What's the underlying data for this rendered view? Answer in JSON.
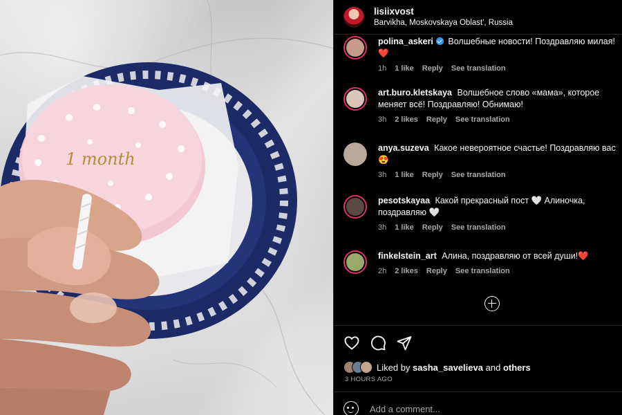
{
  "post": {
    "username": "lisiixvost",
    "location": "Barvikha, Moskovskaya Oblast', Russia",
    "photo_text": "1 month"
  },
  "comments": [
    {
      "user": "polina_askeri",
      "verified": true,
      "text": "Волшебные новости! Поздравляю милая! ❤️",
      "time": "1h",
      "likes": "1 like",
      "reply": "Reply",
      "translate": "See translation",
      "avatar_color": "#c79a8a"
    },
    {
      "user": "art.buro.kletskaya",
      "verified": false,
      "text": "Волшебное слово «мама», которое меняет всё! Поздравляю! Обнимаю!",
      "time": "3h",
      "likes": "2 likes",
      "reply": "Reply",
      "translate": "See translation",
      "avatar_color": "#d8c7b8"
    },
    {
      "user": "anya.suzeva",
      "verified": false,
      "text": "Какое невероятное счастье! Поздравляю вас😍",
      "time": "3h",
      "likes": "1 like",
      "reply": "Reply",
      "translate": "See translation",
      "avatar_color": "#b8a89a"
    },
    {
      "user": "pesotskayaa",
      "verified": false,
      "text": "Какой прекрасный пост 🤍 Алиночка, поздравляю 🤍",
      "time": "3h",
      "likes": "1 like",
      "reply": "Reply",
      "translate": "See translation",
      "avatar_color": "#5a4a44"
    },
    {
      "user": "finkelstein_art",
      "verified": false,
      "text": "Алина, поздравляю от всей души!❤️",
      "time": "2h",
      "likes": "2 likes",
      "reply": "Reply",
      "translate": "See translation",
      "avatar_color": "#9aa86a"
    }
  ],
  "likes": {
    "prefix": "Liked by",
    "user": "sasha_savelieva",
    "and": "and",
    "others": "others",
    "posted": "3 HOURS AGO"
  },
  "composer": {
    "placeholder": "Add a comment..."
  },
  "icons": {
    "like": "heart-icon",
    "comment": "comment-icon",
    "share": "share-icon",
    "more_comments": "plus-circle-icon",
    "emoji": "emoji-icon"
  },
  "colors": {
    "background": "#000000",
    "text": "#f5f5f5",
    "muted": "#a8a8a8",
    "verified": "#3897f0",
    "story_ring": "#e1306c"
  }
}
